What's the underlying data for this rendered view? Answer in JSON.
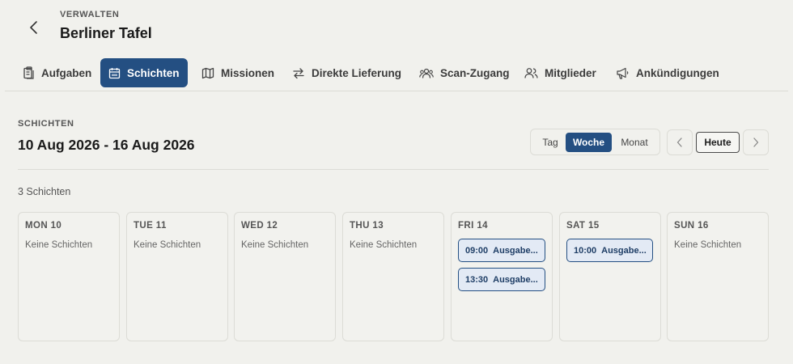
{
  "header": {
    "eyebrow": "VERWALTEN",
    "title": "Berliner Tafel"
  },
  "tabs": [
    {
      "label": "Aufgaben",
      "icon": "clipboard-icon",
      "active": false
    },
    {
      "label": "Schichten",
      "icon": "calendar-icon",
      "active": true
    },
    {
      "label": "Missionen",
      "icon": "map-icon",
      "active": false
    },
    {
      "label": "Direkte Lieferung",
      "icon": "arrows-exchange-icon",
      "active": false
    },
    {
      "label": "Scan-Zugang",
      "icon": "users-group-icon",
      "active": false
    },
    {
      "label": "Mitglieder",
      "icon": "users-icon",
      "active": false
    },
    {
      "label": "Ankündigungen",
      "icon": "megaphone-icon",
      "active": false
    }
  ],
  "schedule": {
    "eyebrow": "SCHICHTEN",
    "range": "10 Aug 2026 - 16 Aug 2026",
    "view_options": [
      "Tag",
      "Woche",
      "Monat"
    ],
    "selected_view": "Woche",
    "today_label": "Heute",
    "count_label": "3 Schichten"
  },
  "days": [
    {
      "label": "MON 10",
      "empty_text": "Keine Schichten",
      "shifts": []
    },
    {
      "label": "TUE 11",
      "empty_text": "Keine Schichten",
      "shifts": []
    },
    {
      "label": "WED 12",
      "empty_text": "Keine Schichten",
      "shifts": []
    },
    {
      "label": "THU 13",
      "empty_text": "Keine Schichten",
      "shifts": []
    },
    {
      "label": "FRI 14",
      "empty_text": "",
      "shifts": [
        {
          "time": "09:00",
          "title": "Ausgabe..."
        },
        {
          "time": "13:30",
          "title": "Ausgabe..."
        }
      ]
    },
    {
      "label": "SAT 15",
      "empty_text": "",
      "shifts": [
        {
          "time": "10:00",
          "title": "Ausgabe..."
        }
      ]
    },
    {
      "label": "SUN 16",
      "empty_text": "Keine Schichten",
      "shifts": []
    }
  ],
  "colors": {
    "accent": "#244f82",
    "background": "#f1f1ed",
    "shift_fill": "#e3eaf5"
  }
}
